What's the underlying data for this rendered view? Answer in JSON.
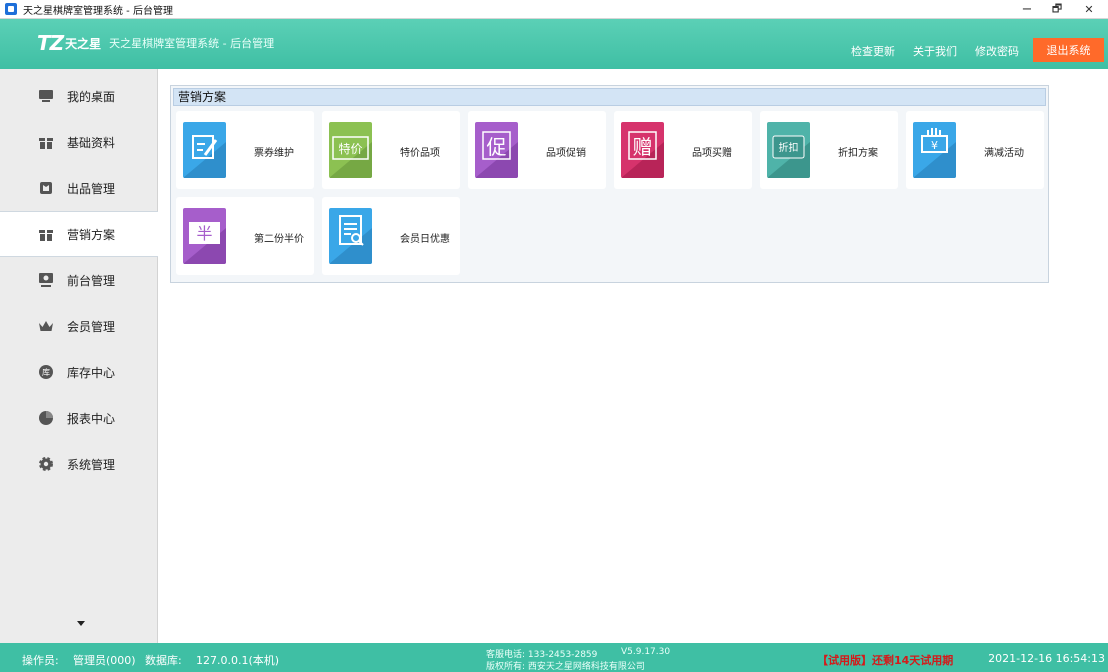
{
  "window": {
    "title": "天之星棋牌室管理系统 - 后台管理",
    "minimize": "−",
    "restore": "🗗",
    "close": "✕"
  },
  "header": {
    "logo_mark": "TZ",
    "logo_brand": "天之星",
    "subtitle": "天之星棋牌室管理系统 - 后台管理",
    "links": {
      "check_update": "检查更新",
      "about": "关于我们",
      "change_password": "修改密码"
    },
    "logout": "退出系统",
    "colors": {
      "header": "#3fbfa4",
      "logout": "#ff6a2a"
    }
  },
  "sidebar": {
    "items": [
      {
        "label": "我的桌面",
        "icon": "monitor-icon"
      },
      {
        "label": "基础资料",
        "icon": "gift-box-icon"
      },
      {
        "label": "出品管理",
        "icon": "shirt-icon"
      },
      {
        "label": "营销方案",
        "icon": "gift-box-icon",
        "active": true
      },
      {
        "label": "前台管理",
        "icon": "screen-user-icon"
      },
      {
        "label": "会员管理",
        "icon": "crown-icon"
      },
      {
        "label": "库存中心",
        "icon": "warehouse-icon",
        "icon_text": "库"
      },
      {
        "label": "报表中心",
        "icon": "pie-chart-icon"
      },
      {
        "label": "系统管理",
        "icon": "gear-icon"
      }
    ]
  },
  "main": {
    "panel_title": "营销方案",
    "tiles": [
      {
        "label": "票券维护",
        "icon": "ticket-edit-icon",
        "color": "#3aa7e8"
      },
      {
        "label": "特价品项",
        "icon": "special-price-icon",
        "icon_text": "特价",
        "color": "#8cc152"
      },
      {
        "label": "品项促销",
        "icon": "promotion-icon",
        "icon_text": "促",
        "color": "#a65ecb"
      },
      {
        "label": "品项买赠",
        "icon": "gift-icon",
        "icon_text": "赠",
        "color": "#d6336c"
      },
      {
        "label": "折扣方案",
        "icon": "discount-icon",
        "icon_text": "折扣",
        "color": "#4fb3a9"
      },
      {
        "label": "满减活动",
        "icon": "money-hand-icon",
        "icon_text": "¥",
        "color": "#3aa7e8"
      },
      {
        "label": "第二份半价",
        "icon": "half-price-icon",
        "icon_text": "半",
        "color": "#a65ecb"
      },
      {
        "label": "会员日优惠",
        "icon": "document-search-icon",
        "color": "#3aa7e8"
      }
    ]
  },
  "status": {
    "operator_label": "操作员:",
    "operator": "管理员(000)",
    "db_label": "数据库:",
    "db": "127.0.0.1(本机)",
    "phone": "客服电话: 133-2453-2859",
    "version": "V5.9.17.30",
    "copyright": "版权所有: 西安天之星网络科技有限公司",
    "trial": "【试用版】还剩14天试用期",
    "datetime": "2021-12-16 16:54:13"
  }
}
